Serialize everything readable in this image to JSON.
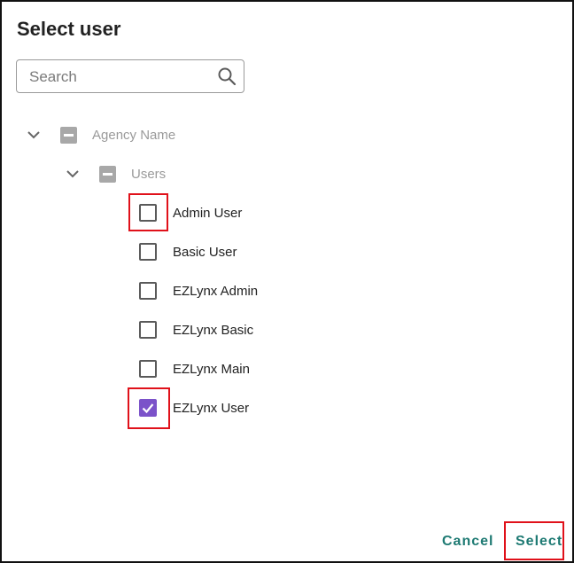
{
  "dialog": {
    "title": "Select user",
    "search": {
      "placeholder": "Search",
      "value": ""
    },
    "tree": {
      "root": {
        "label": "Agency Name",
        "state": "partial"
      },
      "group": {
        "label": "Users",
        "state": "partial"
      },
      "users": [
        {
          "label": "Admin User",
          "checked": false
        },
        {
          "label": "Basic User",
          "checked": false
        },
        {
          "label": "EZLynx Admin",
          "checked": false
        },
        {
          "label": "EZLynx Basic",
          "checked": false
        },
        {
          "label": "EZLynx Main",
          "checked": false
        },
        {
          "label": "EZLynx User",
          "checked": true
        }
      ]
    },
    "actions": {
      "cancel_label": "Cancel",
      "select_label": "Select"
    }
  },
  "colors": {
    "checkbox_checked": "#7b52c9",
    "action_text": "#1e7a73",
    "highlight": "#e0111a"
  }
}
